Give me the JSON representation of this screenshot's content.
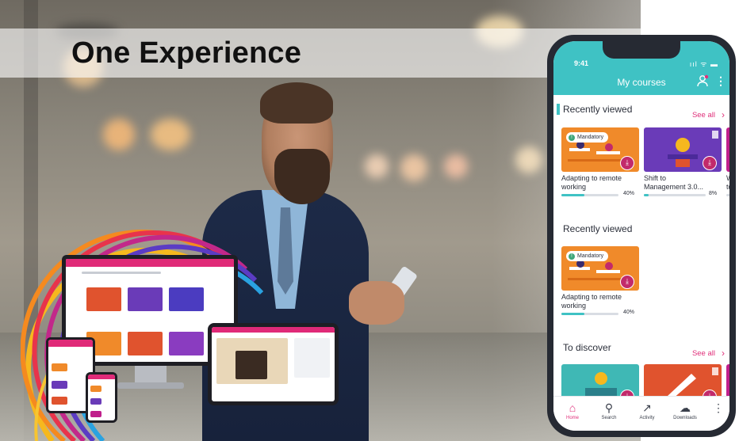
{
  "banner": {
    "title": "One Experience"
  },
  "phone": {
    "status_time": "9:41",
    "status_icons": "ııl ᯤ ▬",
    "header_title": "My courses",
    "avatar_icon": "user-avatar-icon",
    "more_icon": "⋮",
    "sections": [
      {
        "title": "Recently viewed",
        "see_all": "See all",
        "chevron": "›",
        "cards": [
          {
            "badge": "Mandatory",
            "title_line1": "Adapting to remote",
            "title_line2": "working",
            "progress": 40,
            "progress_label": "40%",
            "color": "#f08a2a"
          },
          {
            "badge": "",
            "title_line1": "Shift to",
            "title_line2": "Management 3.0...",
            "progress": 8,
            "progress_label": "8%",
            "color": "#6a3bb8"
          },
          {
            "badge": "",
            "title_line1": "W",
            "title_line2": "to",
            "progress": 0,
            "progress_label": "",
            "color": "#c01f8c"
          }
        ]
      },
      {
        "title": "Recently viewed",
        "cards": [
          {
            "badge": "Mandatory",
            "title_line1": "Adapting to remote",
            "title_line2": "working",
            "progress": 40,
            "progress_label": "40%",
            "color": "#f08a2a"
          }
        ]
      },
      {
        "title": "To discover",
        "see_all": "See all",
        "chevron": "›",
        "cards": [
          {
            "color": "#3fb8b5"
          },
          {
            "color": "#e0532e"
          },
          {
            "color": "#c01f8c"
          }
        ]
      }
    ],
    "nav": [
      {
        "label": "Home",
        "icon": "⌂",
        "active": true
      },
      {
        "label": "Search",
        "icon": "⚲",
        "active": false
      },
      {
        "label": "Activity",
        "icon": "↗",
        "active": false
      },
      {
        "label": "Downloads",
        "icon": "☁",
        "active": false
      },
      {
        "label": "",
        "icon": "⋮",
        "active": false
      }
    ],
    "download_glyph": "⤓",
    "badge_glyph": "!"
  },
  "colors": {
    "accent_teal": "#3fc2c4",
    "accent_pink": "#e0307a",
    "brand_magenta": "#c22a6b"
  }
}
